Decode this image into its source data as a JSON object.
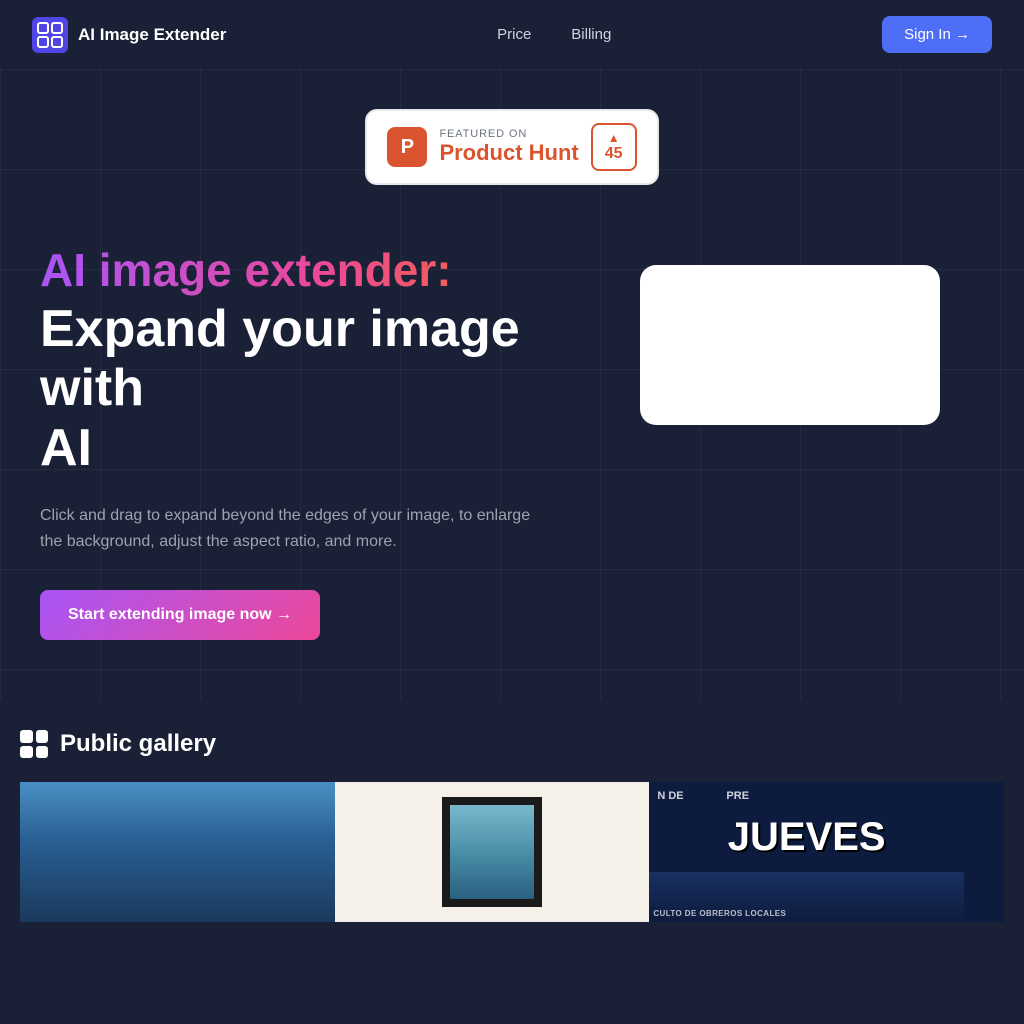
{
  "header": {
    "logo_text": "AI Image Extender",
    "nav": [
      {
        "label": "Price",
        "href": "#"
      },
      {
        "label": "Billing",
        "href": "#"
      }
    ],
    "sign_in_label": "Sign In →"
  },
  "product_hunt": {
    "featured_label": "FEATURED ON",
    "name": "Product Hunt",
    "votes": "45"
  },
  "hero": {
    "title_gradient": "AI image extender:",
    "title_white_line1": "Expand your image with",
    "title_white_line2": "AI",
    "description": "Click and drag to expand beyond the edges of your image, to enlarge the background, adjust the aspect ratio, and more.",
    "cta_label": "Start extending image now →"
  },
  "gallery": {
    "title": "Public gallery",
    "items": [
      {
        "type": "ocean"
      },
      {
        "type": "framed"
      },
      {
        "type": "jueves",
        "top_text": "N DE",
        "main_text": "JUEVES",
        "right_text": "PRE",
        "sub_text": "CULTO DE OBREROS LOCALES"
      }
    ]
  }
}
